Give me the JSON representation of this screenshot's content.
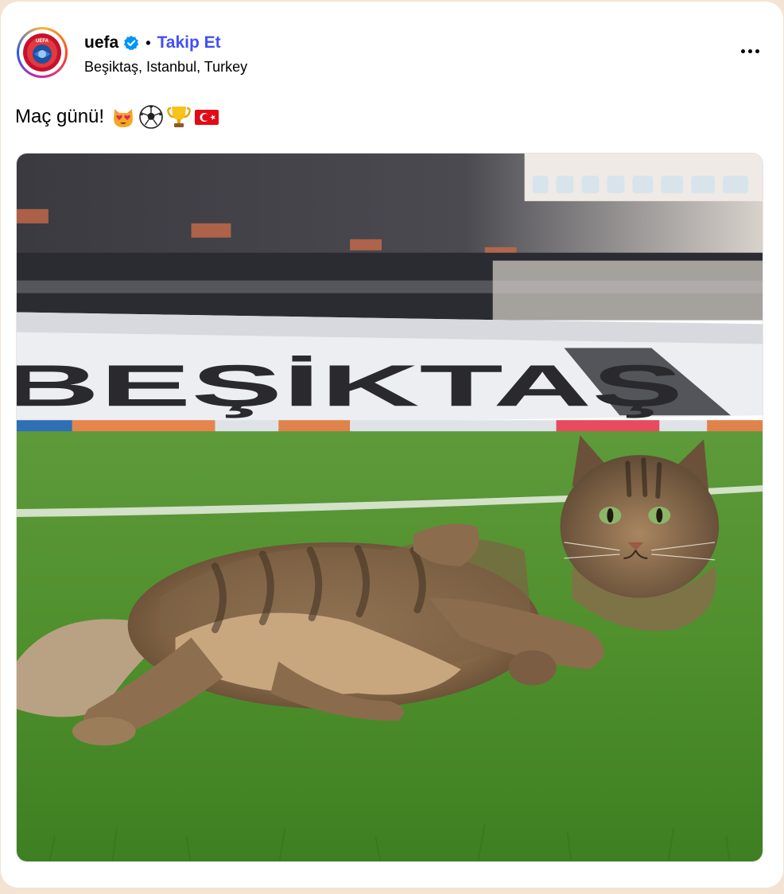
{
  "post": {
    "username": "uefa",
    "separator": "•",
    "follow_label": "Takip Et",
    "location": "Beşiktaş, Istanbul, Turkey",
    "caption": "Maç günü!",
    "caption_emojis": [
      "heart-eyes-cat-icon",
      "soccer-ball-icon",
      "trophy-icon",
      "turkey-flag-icon"
    ],
    "avatar_logo_text": "UEFA"
  },
  "photo": {
    "stand_lettering": "BEŞİKTAŞ"
  },
  "colors": {
    "follow": "#4150f7",
    "verified": "#0095f6",
    "background": "#f3e3d2"
  }
}
